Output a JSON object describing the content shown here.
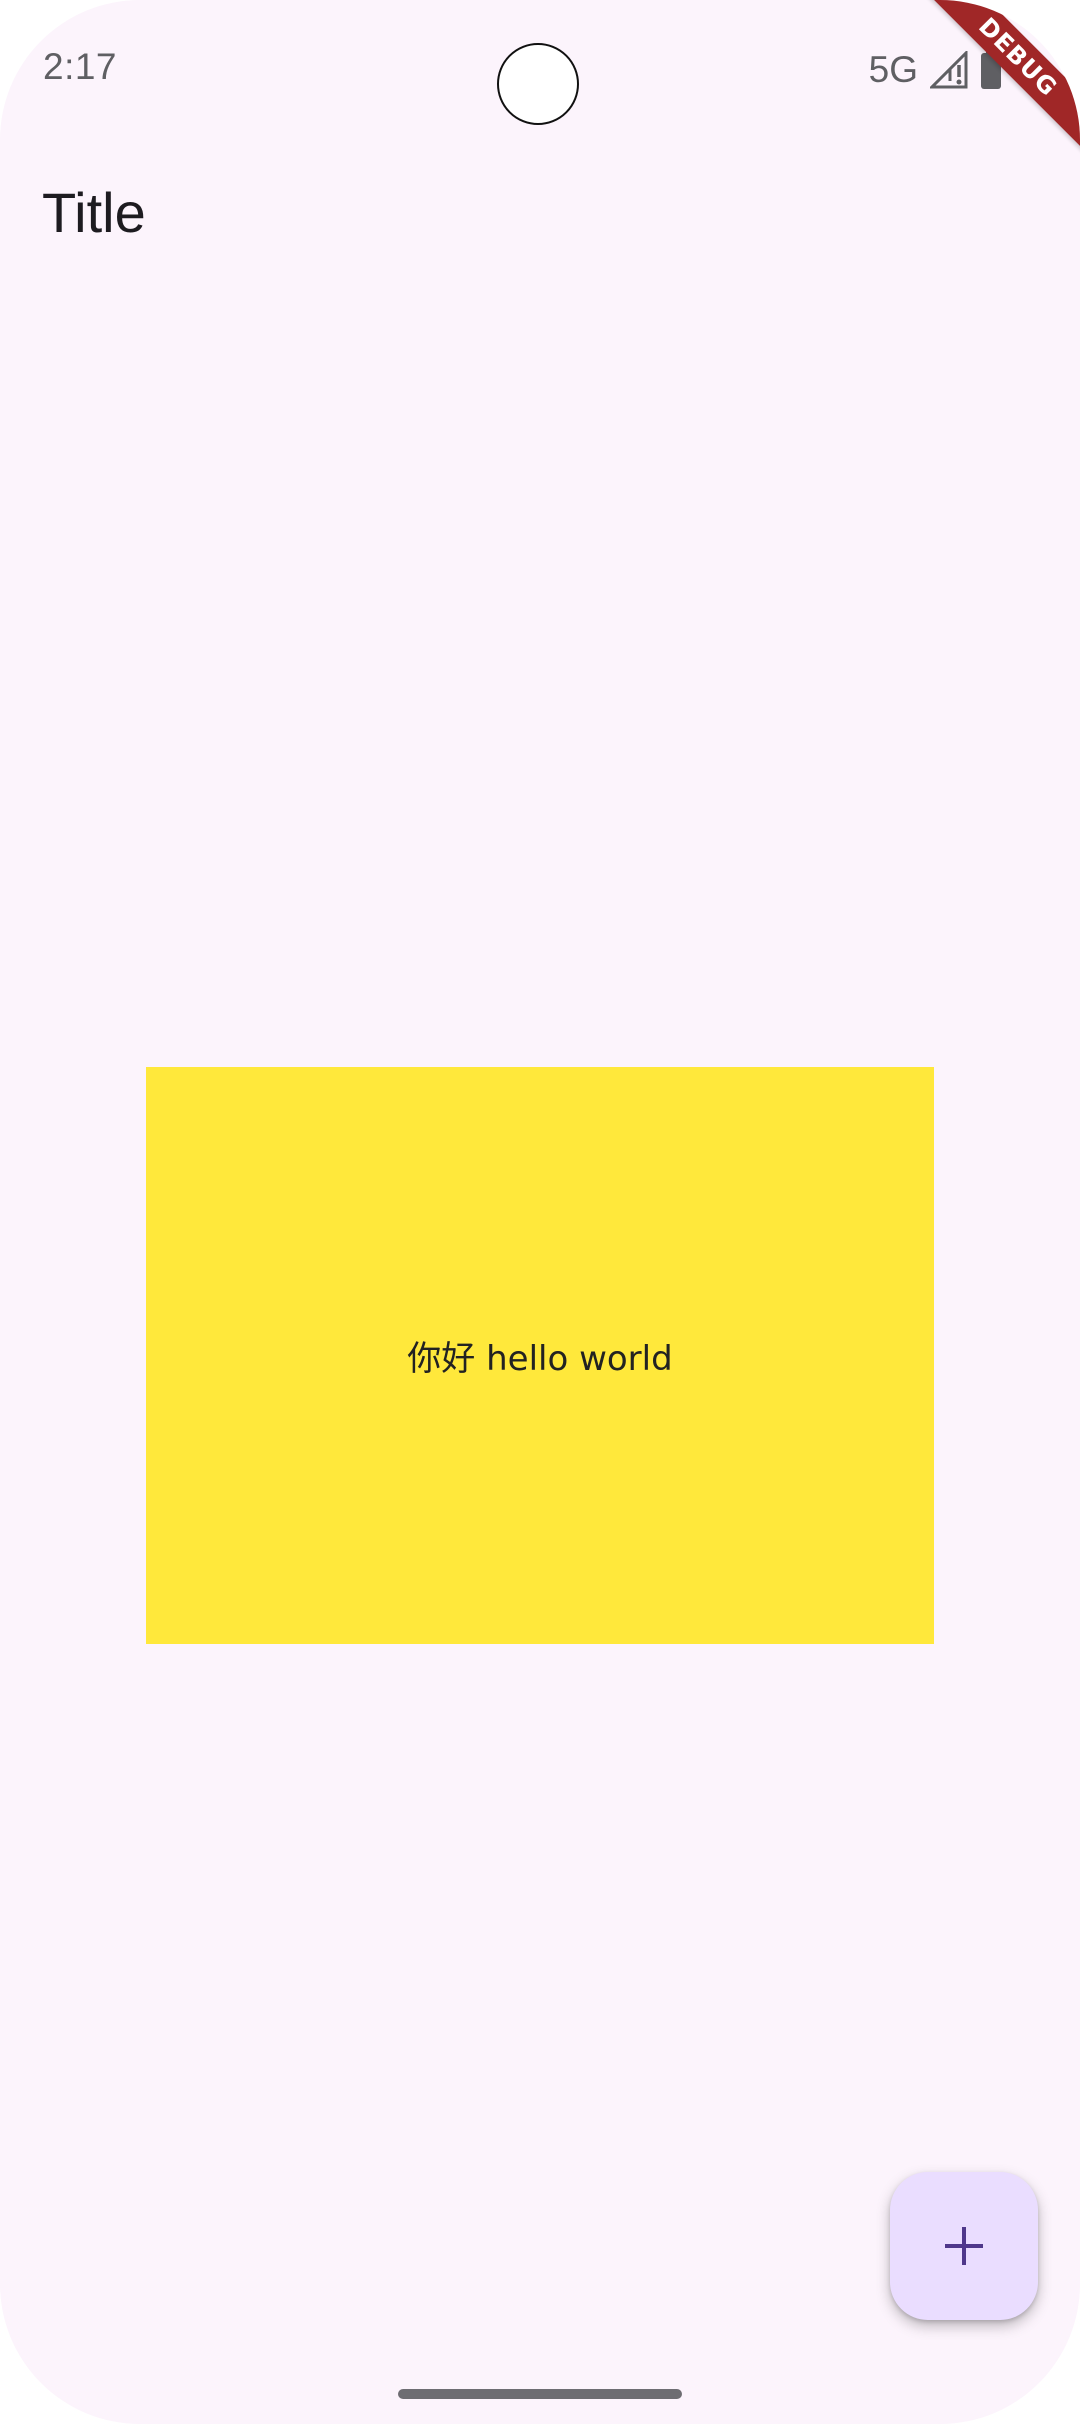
{
  "status_bar": {
    "time": "2:17",
    "network": "5G",
    "icons": [
      "signal-icon",
      "battery-icon"
    ]
  },
  "debug_banner": {
    "label": "DEBUG",
    "color": "#a02727"
  },
  "app_bar": {
    "title": "Title"
  },
  "content": {
    "greeting": "你好 hello world",
    "box_color": "#ffe83b"
  },
  "fab": {
    "icon": "plus-icon",
    "color": "#eaddff",
    "icon_color": "#4f378b"
  },
  "theme": {
    "background": "#fcf4fc",
    "text": "#1d1b20"
  }
}
